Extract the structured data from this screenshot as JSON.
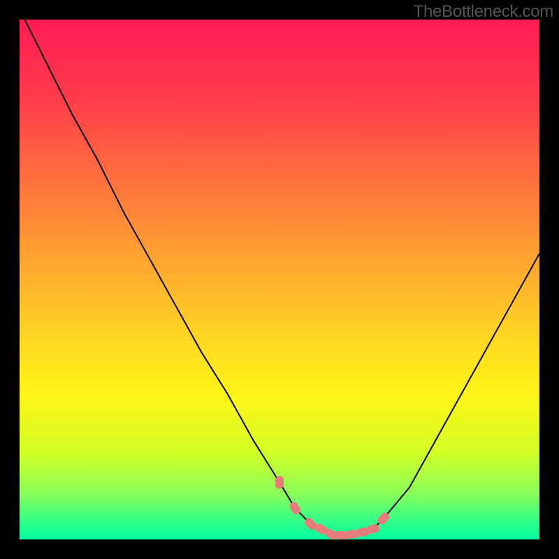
{
  "watermark": "TheBottleneck.com",
  "chart_data": {
    "type": "line",
    "title": "",
    "xlabel": "",
    "ylabel": "",
    "xlim": [
      0,
      100
    ],
    "ylim": [
      0,
      100
    ],
    "grid": false,
    "background_gradient": {
      "type": "vertical",
      "stops": [
        {
          "offset": 0.0,
          "color": "#ff1c55"
        },
        {
          "offset": 0.15,
          "color": "#ff3b4a"
        },
        {
          "offset": 0.3,
          "color": "#ff6e3e"
        },
        {
          "offset": 0.45,
          "color": "#ffa031"
        },
        {
          "offset": 0.6,
          "color": "#ffd324"
        },
        {
          "offset": 0.72,
          "color": "#fff417"
        },
        {
          "offset": 0.83,
          "color": "#d4ff24"
        },
        {
          "offset": 0.91,
          "color": "#8cff5a"
        },
        {
          "offset": 0.97,
          "color": "#2cff8c"
        },
        {
          "offset": 1.0,
          "color": "#00ffa0"
        }
      ]
    },
    "series": [
      {
        "name": "bottleneck-curve",
        "x": [
          0,
          5,
          10,
          15,
          20,
          25,
          30,
          35,
          40,
          45,
          50,
          53,
          56,
          60,
          64,
          68,
          70,
          75,
          80,
          85,
          90,
          95,
          100
        ],
        "y": [
          102,
          92,
          82,
          73,
          63,
          54,
          45,
          36,
          28,
          19,
          11,
          6,
          3,
          1,
          1,
          2,
          4,
          10,
          19,
          28,
          37,
          46,
          55
        ],
        "stroke": "#000000",
        "stroke_width": 2
      }
    ],
    "highlight_zone": {
      "name": "low-bottleneck-markers",
      "color": "#e77a7a",
      "points_x": [
        50,
        53,
        56,
        58,
        60,
        62,
        64,
        66,
        68,
        70
      ],
      "points_y": [
        11,
        6,
        3,
        2,
        1,
        0.8,
        1,
        1.4,
        2,
        4
      ]
    }
  }
}
